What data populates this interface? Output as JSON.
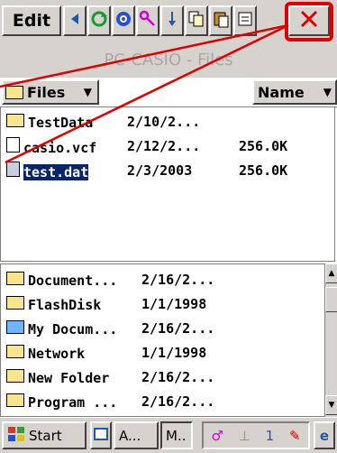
{
  "toolbar": {
    "edit_label": "Edit",
    "icons": [
      "back-arrow-icon",
      "refresh-icon",
      "network-icon",
      "key-icon",
      "download-arrow-icon",
      "copy-icon",
      "paste-icon",
      "close-icon"
    ],
    "highlight_color": "#e00000"
  },
  "window": {
    "title": "PC-CASIO - Files"
  },
  "header": {
    "folder_label": "Files",
    "sort_column": "Name"
  },
  "files": [
    {
      "name": "TestData",
      "date": "2/10/2...",
      "size": "",
      "type": "folder"
    },
    {
      "name": "casio.vcf",
      "date": "2/12/2...",
      "size": "256.0K",
      "type": "file"
    },
    {
      "name": "test.dat",
      "date": "2/3/2003",
      "size": "256.0K",
      "type": "file",
      "selected": true
    }
  ],
  "folders": [
    {
      "name": "Document...",
      "date": "2/16/2..."
    },
    {
      "name": "FlashDisk",
      "date": "1/1/1998"
    },
    {
      "name": "My Docum...",
      "date": "2/16/2..."
    },
    {
      "name": "Network",
      "date": "1/1/1998"
    },
    {
      "name": "New Folder",
      "date": "2/16/2..."
    },
    {
      "name": "Program ...",
      "date": "2/16/2..."
    }
  ],
  "taskbar": {
    "start_label": "Start",
    "task1_label": "A...",
    "task2_label": "M..",
    "clock_digit": "1"
  }
}
